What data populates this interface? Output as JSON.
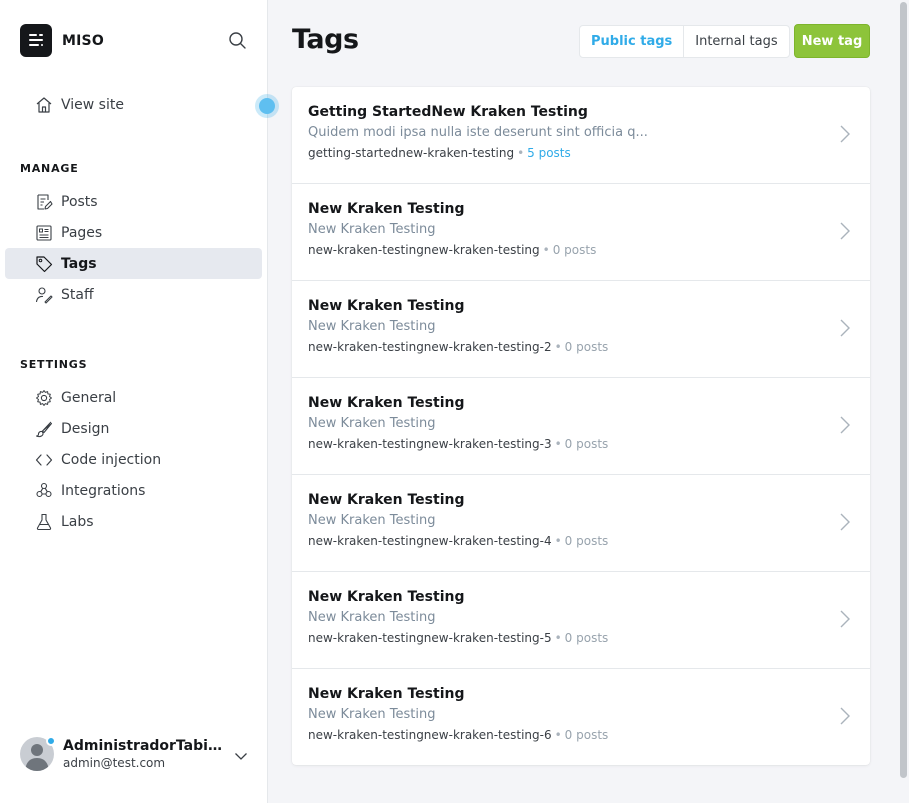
{
  "brand": {
    "name": "MISO"
  },
  "nav": {
    "view_site": "View site",
    "manage_heading": "MANAGE",
    "manage_items": [
      {
        "label": "Posts",
        "icon": "posts-icon"
      },
      {
        "label": "Pages",
        "icon": "pages-icon"
      },
      {
        "label": "Tags",
        "icon": "tag-icon",
        "active": true
      },
      {
        "label": "Staff",
        "icon": "staff-icon"
      }
    ],
    "settings_heading": "SETTINGS",
    "settings_items": [
      {
        "label": "General",
        "icon": "gear-icon"
      },
      {
        "label": "Design",
        "icon": "brush-icon"
      },
      {
        "label": "Code injection",
        "icon": "code-icon"
      },
      {
        "label": "Integrations",
        "icon": "integrations-icon"
      },
      {
        "label": "Labs",
        "icon": "flask-icon"
      }
    ]
  },
  "user": {
    "name": "AdministradorTabith...",
    "email": "admin@test.com"
  },
  "main": {
    "title": "Tags",
    "tabs": [
      {
        "label": "Public tags",
        "active": true
      },
      {
        "label": "Internal tags",
        "active": false
      }
    ],
    "new_button": "New tag"
  },
  "tags": [
    {
      "name": "Getting StartedNew Kraken Testing",
      "description": "Quidem modi ipsa nulla iste deserunt sint officia q...",
      "slug": "getting-startednew-kraken-testing",
      "posts": "5 posts"
    },
    {
      "name": "New Kraken Testing",
      "description": "New Kraken Testing",
      "slug": "new-kraken-testingnew-kraken-testing",
      "posts": "0 posts"
    },
    {
      "name": "New Kraken Testing",
      "description": "New Kraken Testing",
      "slug": "new-kraken-testingnew-kraken-testing-2",
      "posts": "0 posts"
    },
    {
      "name": "New Kraken Testing",
      "description": "New Kraken Testing",
      "slug": "new-kraken-testingnew-kraken-testing-3",
      "posts": "0 posts"
    },
    {
      "name": "New Kraken Testing",
      "description": "New Kraken Testing",
      "slug": "new-kraken-testingnew-kraken-testing-4",
      "posts": "0 posts"
    },
    {
      "name": "New Kraken Testing",
      "description": "New Kraken Testing",
      "slug": "new-kraken-testingnew-kraken-testing-5",
      "posts": "0 posts"
    },
    {
      "name": "New Kraken Testing",
      "description": "New Kraken Testing",
      "slug": "new-kraken-testingnew-kraken-testing-6",
      "posts": "0 posts"
    }
  ],
  "colors": {
    "accent": "#30abe8",
    "primary_button": "#8dc43a",
    "text": "#15171a",
    "muted": "#7c8b9a"
  }
}
